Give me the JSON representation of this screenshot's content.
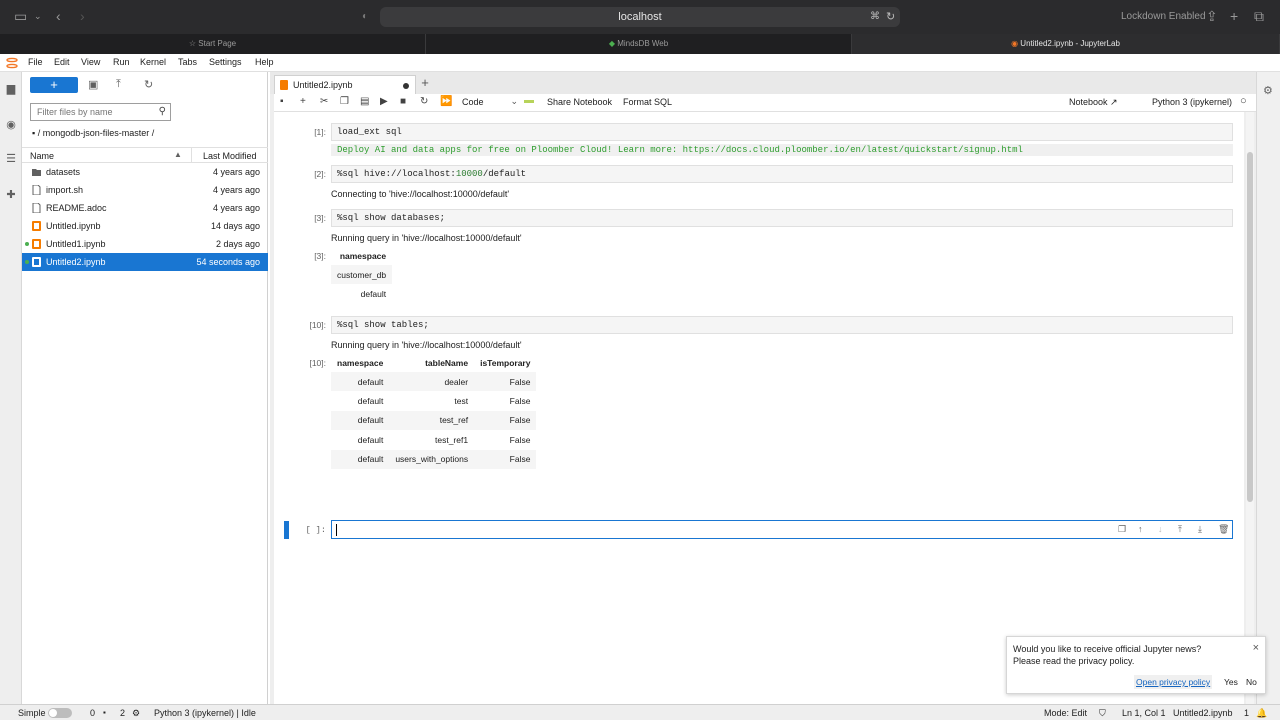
{
  "browser": {
    "url": "localhost",
    "lockdown": "Lockdown Enabled",
    "tabs": [
      {
        "label": "Start Page"
      },
      {
        "label": "MindsDB Web"
      },
      {
        "label": "Untitled2.ipynb - JupyterLab"
      }
    ]
  },
  "menu": [
    "File",
    "Edit",
    "View",
    "Run",
    "Kernel",
    "Tabs",
    "Settings",
    "Help"
  ],
  "filebrowser": {
    "new_label": "+",
    "filter_placeholder": "Filter files by name",
    "breadcrumb": "/ mongodb-json-files-master /",
    "col_name": "Name",
    "col_modified": "Last Modified",
    "files": [
      {
        "name": "datasets",
        "modified": "4 years ago",
        "type": "folder"
      },
      {
        "name": "import.sh",
        "modified": "4 years ago",
        "type": "file"
      },
      {
        "name": "README.adoc",
        "modified": "4 years ago",
        "type": "file"
      },
      {
        "name": "Untitled.ipynb",
        "modified": "14 days ago",
        "type": "notebook"
      },
      {
        "name": "Untitled1.ipynb",
        "modified": "2 days ago",
        "type": "notebook"
      },
      {
        "name": "Untitled2.ipynb",
        "modified": "54 seconds ago",
        "type": "notebook"
      }
    ]
  },
  "notebook": {
    "tab_title": "Untitled2.ipynb",
    "cell_type": "Code",
    "share_label": "Share Notebook",
    "format_label": "Format SQL",
    "notebook_label": "Notebook",
    "kernel": "Python 3 (ipykernel)",
    "cells": {
      "c1": {
        "prompt": "[1]:",
        "code": "load_ext sql",
        "banner": "Deploy AI and data apps for free on Ploomber Cloud! Learn more: https://docs.cloud.ploomber.io/en/latest/quickstart/signup.html"
      },
      "c2": {
        "prompt": "[2]:",
        "code_pre": "%sql hive://localhost:",
        "code_num": "10000",
        "code_post": "/default",
        "output": "Connecting to 'hive://localhost:10000/default'"
      },
      "c3": {
        "prompt": "[3]:",
        "code": "%sql show databases;",
        "output": "Running query in 'hive://localhost:10000/default'",
        "out_prompt": "[3]:",
        "header": "namespace",
        "rows": [
          "customer_db",
          "default"
        ]
      },
      "c10": {
        "prompt": "[10]:",
        "code": "%sql show tables;",
        "output": "Running query in 'hive://localhost:10000/default'",
        "out_prompt": "[10]:",
        "headers": [
          "namespace",
          "tableName",
          "isTemporary"
        ],
        "rows": [
          {
            "ns": "default",
            "table": "dealer",
            "temp": "False"
          },
          {
            "ns": "default",
            "table": "test",
            "temp": "False"
          },
          {
            "ns": "default",
            "table": "test_ref",
            "temp": "False"
          },
          {
            "ns": "default",
            "table": "test_ref1",
            "temp": "False"
          },
          {
            "ns": "default",
            "table": "users_with_options",
            "temp": "False"
          }
        ]
      },
      "active": {
        "prompt": "[ ]:"
      }
    }
  },
  "toast": {
    "line1": "Would you like to receive official Jupyter news?",
    "line2": "Please read the privacy policy.",
    "privacy": "Open privacy policy",
    "yes": "Yes",
    "no": "No"
  },
  "status": {
    "mode": "Simple",
    "count1": "0",
    "count2": "2",
    "kernel_status": "Python 3 (ipykernel) | Idle",
    "edit_mode": "Mode: Edit",
    "position": "Ln 1, Col 1",
    "filename": "Untitled2.ipynb",
    "notif_count": "1"
  }
}
